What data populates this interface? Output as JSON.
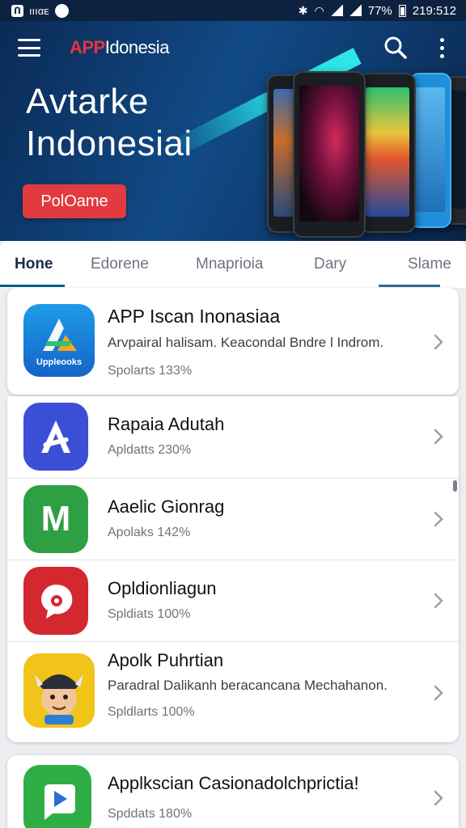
{
  "status_bar": {
    "left_chip": "ᑎ",
    "left_text": "ıııαᴇ",
    "battery_text": "77%",
    "time": "219:512"
  },
  "header": {
    "logo_accent": "APP",
    "logo_rest": "Idonesia",
    "menu_icon": "hamburger-menu-icon",
    "search_icon": "search-icon",
    "more_icon": "more-vert-icon"
  },
  "hero": {
    "title_line1": "Avtarke",
    "title_line2": "Indonesiai",
    "cta_label": "PolOame"
  },
  "tabs": [
    {
      "label": "Hone",
      "active": true
    },
    {
      "label": "Edorene",
      "active": false
    },
    {
      "label": "Mnaprioia",
      "active": false
    },
    {
      "label": "Dary",
      "active": false
    },
    {
      "label": "Slame",
      "active": false
    }
  ],
  "featured": {
    "title": "APP Iscan Inonasiaa",
    "description": "Arvpairal halisam. Keacondal Bndre l Indrom.",
    "meta": "Spolarts 133%",
    "icon_label": "Uppleooks",
    "icon": "app-tile-icon"
  },
  "apps": [
    {
      "title": "Rapaia Adutah",
      "meta": "Apldatts 230%",
      "icon": "letter-a-icon",
      "icon_color": "#3b4fd6"
    },
    {
      "title": "Aaelic Gionrag",
      "meta": "Apolaks 142%",
      "icon": "letter-m-icon",
      "icon_color": "#2ea043",
      "glyph": "M"
    },
    {
      "title": "Opldionliagun",
      "meta": "Spldiats 100%",
      "icon": "chat-bubble-icon",
      "icon_color": "#d3282e"
    },
    {
      "title": "Apolk Puhrtian",
      "description": "Paradral Dalikanh beracancana Mechahanon.",
      "meta": "Spldlarts 100%",
      "icon": "cartoon-character-icon",
      "icon_color": "#f0c419"
    }
  ],
  "last_app": {
    "title": "Applkscian Casionadolchprictia!",
    "meta": "Spddats 180%",
    "icon": "play-chat-icon",
    "icon_color": "#2fae45"
  },
  "colors": {
    "header_bg": "#114a86",
    "accent_red": "#e23a3f",
    "tab_active_underline": "#0c5c8c"
  }
}
